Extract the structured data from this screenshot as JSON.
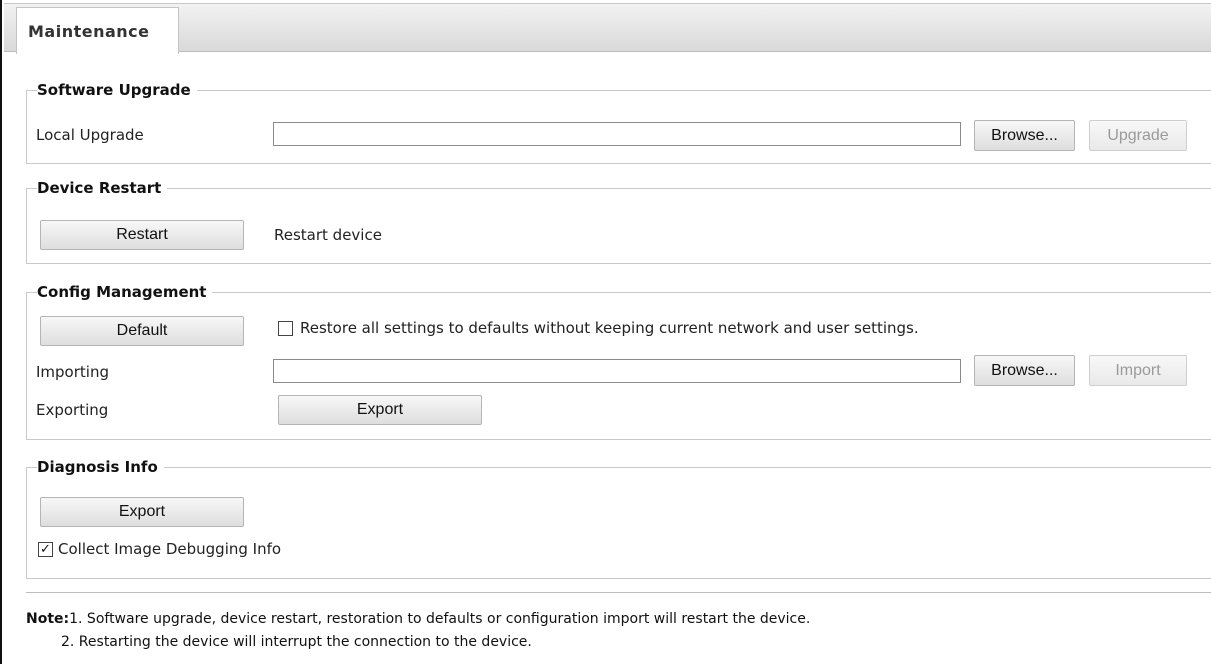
{
  "tab": {
    "label": "Maintenance"
  },
  "software_upgrade": {
    "title": "Software Upgrade",
    "local_upgrade_label": "Local Upgrade",
    "file_value": "",
    "browse_label": "Browse...",
    "upgrade_label": "Upgrade"
  },
  "device_restart": {
    "title": "Device Restart",
    "restart_label": "Restart",
    "restart_desc": "Restart device"
  },
  "config_management": {
    "title": "Config Management",
    "default_label": "Default",
    "restore_all_checked": false,
    "restore_all_text": "Restore all settings to defaults without keeping current network and user settings.",
    "importing_label": "Importing",
    "import_file_value": "",
    "browse_label": "Browse...",
    "import_label": "Import",
    "exporting_label": "Exporting",
    "export_label": "Export"
  },
  "diagnosis_info": {
    "title": "Diagnosis Info",
    "export_label": "Export",
    "collect_checked": true,
    "collect_text": "Collect Image Debugging Info"
  },
  "note": {
    "prefix": "Note:",
    "line1": "1. Software upgrade, device restart, restoration to defaults or configuration import will restart the device.",
    "line2": "2. Restarting the device will interrupt the connection to the device."
  }
}
